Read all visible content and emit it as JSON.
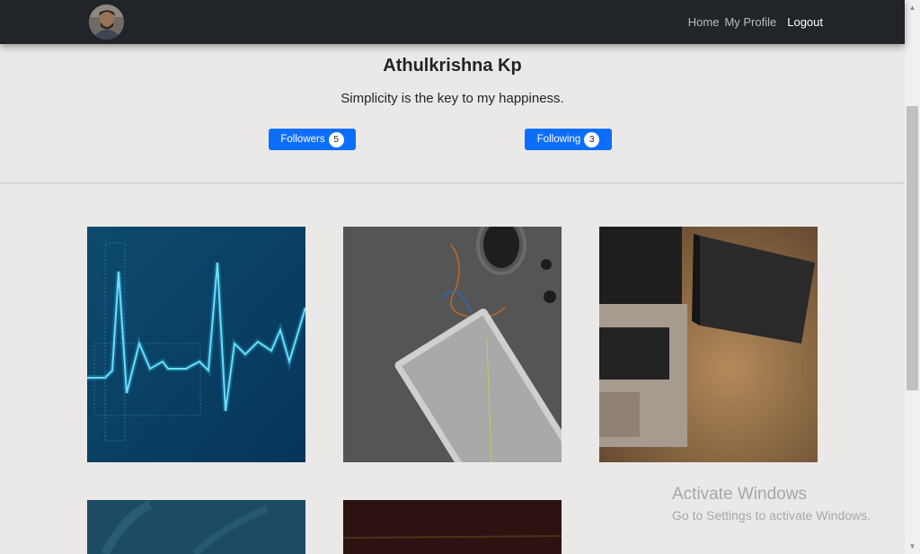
{
  "nav": {
    "links": [
      "Home",
      "My Profile",
      "Logout"
    ]
  },
  "profile": {
    "name": "Athulkrishna Kp",
    "bio": "Simplicity is the key to my happiness.",
    "followers_label": "Followers",
    "followers_count": "5",
    "following_label": "Following",
    "following_count": "3"
  },
  "posts": [
    {
      "icon": "heartbeat-ekg-image"
    },
    {
      "icon": "keyboard-desk-image"
    },
    {
      "icon": "laptop-desk-image"
    },
    {
      "icon": "plant-leaves-image"
    },
    {
      "icon": "dark-wood-image"
    }
  ],
  "watermark": {
    "title": "Activate Windows",
    "subtitle": "Go to Settings to activate Windows."
  },
  "colors": {
    "navbar": "#212529",
    "accent": "#0d6efd",
    "background": "#ebe9e8"
  }
}
